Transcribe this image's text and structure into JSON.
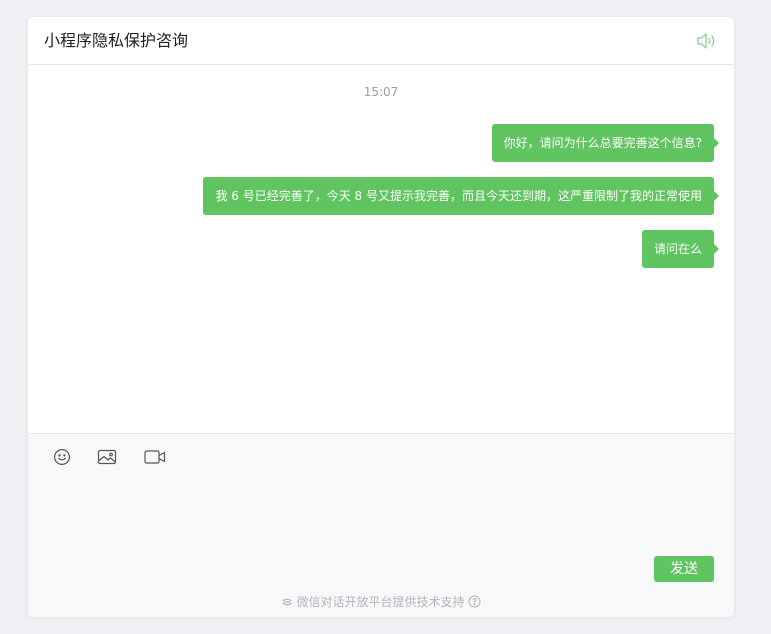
{
  "header": {
    "title": "小程序隐私保护咨询",
    "speaker_icon": "speaker-icon"
  },
  "chat": {
    "timestamp": "15:07",
    "messages": [
      {
        "text": "你好，请问为什么总要完善这个信息?"
      },
      {
        "text": "我 6 号已经完善了，今天 8 号又提示我完善，而且今天还到期，这严重限制了我的正常使用"
      },
      {
        "text": "请问在么"
      }
    ]
  },
  "composer": {
    "tools": [
      "emoji-icon",
      "image-icon",
      "video-icon"
    ],
    "send_label": "发送",
    "footer_text": "微信对话开放平台提供技术支持"
  },
  "colors": {
    "accent": "#60c460",
    "page_bg": "#eef0f3",
    "composer_bg": "#f7f8fa"
  }
}
